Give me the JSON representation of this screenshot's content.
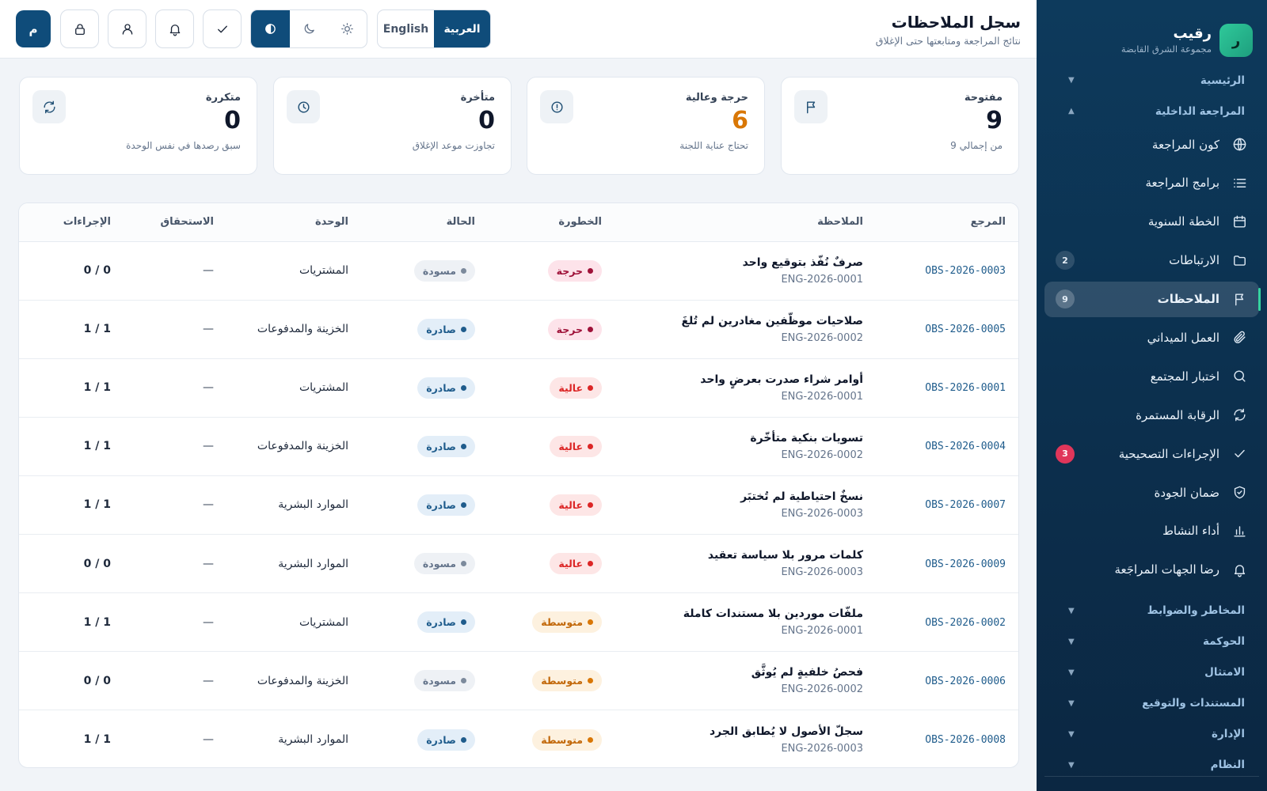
{
  "brand": {
    "logo_letter": "ر",
    "name": "رقيب",
    "subtitle": "مجموعة الشرق القابضة"
  },
  "sidebar": {
    "group_home": "الرئيسية",
    "group_internal_audit": "المراجعة الداخلية",
    "items": [
      {
        "label": "كون المراجعة",
        "icon": "globe-icon"
      },
      {
        "label": "برامج المراجعة",
        "icon": "list-icon"
      },
      {
        "label": "الخطة السنوية",
        "icon": "calendar-icon"
      },
      {
        "label": "الارتباطات",
        "icon": "folder-icon",
        "badge": "2"
      },
      {
        "label": "الملاحظات",
        "icon": "flag-icon",
        "badge": "9",
        "active": true
      },
      {
        "label": "العمل الميداني",
        "icon": "paperclip-icon"
      },
      {
        "label": "اختبار المجتمع",
        "icon": "search-icon"
      },
      {
        "label": "الرقابة المستمرة",
        "icon": "refresh-icon"
      },
      {
        "label": "الإجراءات التصحيحية",
        "icon": "check-icon",
        "badge": "3"
      },
      {
        "label": "ضمان الجودة",
        "icon": "shield-icon"
      },
      {
        "label": "أداء النشاط",
        "icon": "bar-chart-icon"
      },
      {
        "label": "رضا الجهات المراجَعة",
        "icon": "bell-icon"
      }
    ],
    "collapsed_groups": [
      "المخاطر والضوابط",
      "الحوكمة",
      "الامتثال",
      "المستندات والتوقيع",
      "الإدارة",
      "النظام"
    ]
  },
  "header": {
    "title": "سجل الملاحظات",
    "subtitle": "نتائج المراجعة ومتابعتها حتى الإغلاق",
    "lang_ar": "العربية",
    "lang_en": "English",
    "avatar_letter": "م"
  },
  "stats": [
    {
      "label": "مفتوحة",
      "value": "9",
      "hint": "من إجمالي 9",
      "icon": "flag-icon"
    },
    {
      "label": "حرجة وعالية",
      "value": "6",
      "hint": "تحتاج عناية اللجنة",
      "icon": "alert-circle-icon"
    },
    {
      "label": "متأخرة",
      "value": "0",
      "hint": "تجاوزت موعد الإغلاق",
      "icon": "clock-icon"
    },
    {
      "label": "متكررة",
      "value": "0",
      "hint": "سبق رصدها في نفس الوحدة",
      "icon": "refresh-icon"
    }
  ],
  "table": {
    "headers": {
      "ref": "المرجع",
      "obs": "الملاحظة",
      "sev": "الخطورة",
      "status": "الحالة",
      "unit": "الوحدة",
      "due": "الاستحقاق",
      "actions": "الإجراءات"
    },
    "rows": [
      {
        "ref": "OBS-2026-0003",
        "title": "صرفٌ نُفّذ بتوقيع واحد",
        "eng": "ENG-2026-0001",
        "sev": "حرجة",
        "sev_level": "critical",
        "status": "مسودة",
        "status_level": "draft",
        "unit": "المشتريات",
        "due": "—",
        "actions": "0 / 0"
      },
      {
        "ref": "OBS-2026-0005",
        "title": "صلاحيات موظّفين مغادرين لم تُلغَ",
        "eng": "ENG-2026-0002",
        "sev": "حرجة",
        "sev_level": "critical",
        "status": "صادرة",
        "status_level": "issued",
        "unit": "الخزينة والمدفوعات",
        "due": "—",
        "actions": "1 / 1"
      },
      {
        "ref": "OBS-2026-0001",
        "title": "أوامر شراء صدرت بعرضٍ واحد",
        "eng": "ENG-2026-0001",
        "sev": "عالية",
        "sev_level": "high",
        "status": "صادرة",
        "status_level": "issued",
        "unit": "المشتريات",
        "due": "—",
        "actions": "1 / 1"
      },
      {
        "ref": "OBS-2026-0004",
        "title": "تسويات بنكية متأخّرة",
        "eng": "ENG-2026-0002",
        "sev": "عالية",
        "sev_level": "high",
        "status": "صادرة",
        "status_level": "issued",
        "unit": "الخزينة والمدفوعات",
        "due": "—",
        "actions": "1 / 1"
      },
      {
        "ref": "OBS-2026-0007",
        "title": "نسخٌ احتياطية لم تُختبَر",
        "eng": "ENG-2026-0003",
        "sev": "عالية",
        "sev_level": "high",
        "status": "صادرة",
        "status_level": "issued",
        "unit": "الموارد البشرية",
        "due": "—",
        "actions": "1 / 1"
      },
      {
        "ref": "OBS-2026-0009",
        "title": "كلمات مرور بلا سياسة تعقيد",
        "eng": "ENG-2026-0003",
        "sev": "عالية",
        "sev_level": "high",
        "status": "مسودة",
        "status_level": "draft",
        "unit": "الموارد البشرية",
        "due": "—",
        "actions": "0 / 0"
      },
      {
        "ref": "OBS-2026-0002",
        "title": "ملفّات موردين بلا مستندات كاملة",
        "eng": "ENG-2026-0001",
        "sev": "متوسطة",
        "sev_level": "medium",
        "status": "صادرة",
        "status_level": "issued",
        "unit": "المشتريات",
        "due": "—",
        "actions": "1 / 1"
      },
      {
        "ref": "OBS-2026-0006",
        "title": "فحصُ خلفيةٍ لم يُوثَّق",
        "eng": "ENG-2026-0002",
        "sev": "متوسطة",
        "sev_level": "medium",
        "status": "مسودة",
        "status_level": "draft",
        "unit": "الخزينة والمدفوعات",
        "due": "—",
        "actions": "0 / 0"
      },
      {
        "ref": "OBS-2026-0008",
        "title": "سجلّ الأصول لا يُطابق الجرد",
        "eng": "ENG-2026-0003",
        "sev": "متوسطة",
        "sev_level": "medium",
        "status": "صادرة",
        "status_level": "issued",
        "unit": "الموارد البشرية",
        "due": "—",
        "actions": "1 / 1"
      }
    ]
  },
  "colors": {
    "primary": "#0f4c7a",
    "sidebar": "#0d3a5c",
    "accent": "#35d3a0",
    "danger": "#e0365a",
    "warn": "#d97706"
  }
}
